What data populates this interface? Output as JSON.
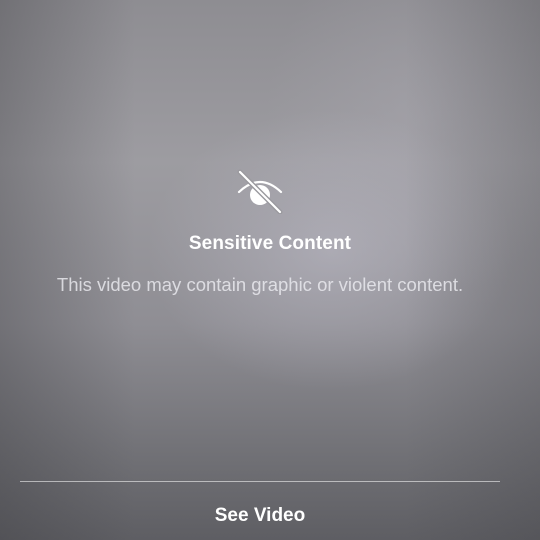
{
  "warning": {
    "icon": "eye-slash-icon",
    "title": "Sensitive Content",
    "description": "This video may contain graphic or violent content."
  },
  "actions": {
    "see_video_label": "See Video"
  },
  "colors": {
    "text": "#ffffff",
    "description_text": "#ebebf0",
    "background": "#8e8d92"
  }
}
